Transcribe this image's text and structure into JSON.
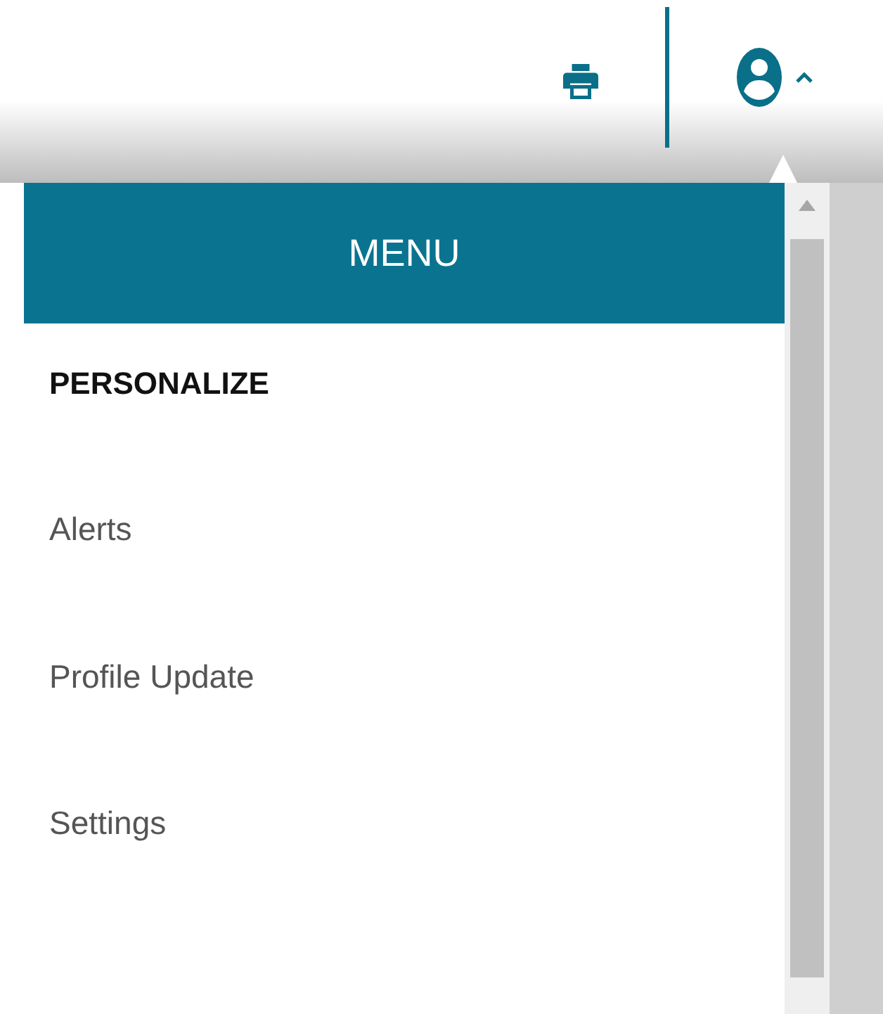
{
  "header": {
    "user_menu": {
      "expanded": true
    }
  },
  "menu": {
    "title": "MENU",
    "sections": [
      {
        "heading": "PERSONALIZE",
        "items": [
          {
            "label": "Alerts"
          },
          {
            "label": "Profile Update"
          },
          {
            "label": "Settings"
          }
        ]
      }
    ]
  }
}
